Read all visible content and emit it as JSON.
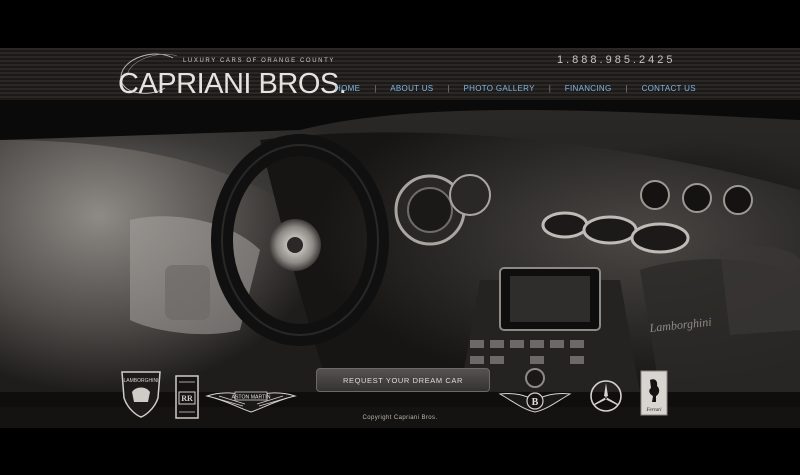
{
  "header": {
    "tagline": "LUXURY CARS OF ORANGE COUNTY",
    "brand": "CAPRIANI BROS.",
    "phone": "1.888.985.2425"
  },
  "nav": {
    "items": [
      "HOME",
      "ABOUT US",
      "PHOTO GALLERY",
      "FINANCING",
      "CONTACT US"
    ]
  },
  "cta": {
    "label": "REQUEST YOUR DREAM CAR"
  },
  "brands": {
    "logos": [
      "lamborghini-logo",
      "rolls-royce-logo",
      "aston-martin-logo",
      "bentley-logo",
      "mercedes-logo",
      "ferrari-logo"
    ],
    "lamborghini_text": "LAMBORGHINI",
    "aston_text": "ASTON MARTIN",
    "ferrari_text": "Ferrari"
  },
  "footer": {
    "copyright": "Copyright Capriani Bros."
  },
  "colors": {
    "nav_link": "#7fb6e6",
    "background": "#000000"
  }
}
